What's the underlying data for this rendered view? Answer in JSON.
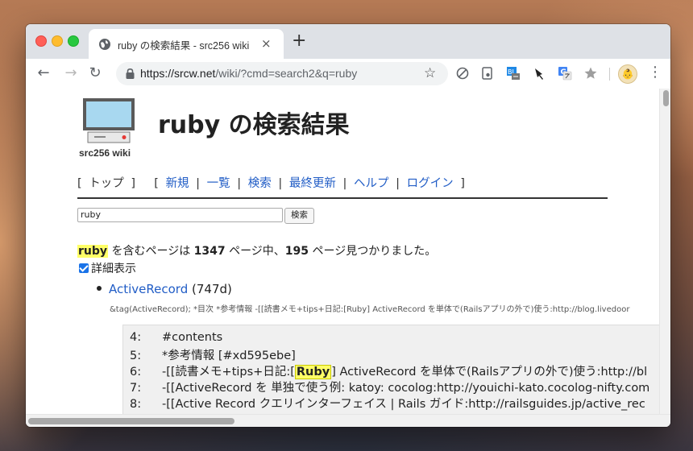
{
  "browser": {
    "tab_title": "ruby の検索結果 - src256 wiki",
    "tab_close": "×",
    "new_tab": "+",
    "url_host": "https://srcw.net",
    "url_path": "/wiki/?cmd=search2&q=ruby",
    "back": "←",
    "forward": "→",
    "reload": "↻",
    "bookmark_star": "☆",
    "menu": "⋮",
    "extensions": [
      "block-icon",
      "pocket-icon",
      "blog-icon",
      "pin-icon",
      "translate-icon",
      "star-extension-icon"
    ],
    "avatar_glyph": "👶"
  },
  "site": {
    "logo_caption": "src256 wiki",
    "page_title": "ruby の検索結果"
  },
  "nav": {
    "open_bracket": "[",
    "close_bracket": "]",
    "top": "トップ",
    "items": [
      "新規",
      "一覧",
      "検索",
      "最終更新",
      "ヘルプ",
      "ログイン"
    ],
    "separator": "|"
  },
  "search": {
    "query": "ruby",
    "button": "検索"
  },
  "summary": {
    "keyword": "ruby",
    "text_before": " を含むページは ",
    "total": "1347",
    "text_middle": " ページ中、",
    "found": "195",
    "text_after": " ページ見つかりました。"
  },
  "detail_toggle": {
    "label": "詳細表示",
    "checked": true
  },
  "results": [
    {
      "title": "ActiveRecord",
      "age": " (747d)",
      "snippet": "&tag(ActiveRecord); *目次 *参考情報 -[[読書メモ+tips+日記:[Ruby] ActiveRecord を単体で(Railsアプリの外で)使う:http://blog.livedoor",
      "lines": [
        {
          "num": "4:",
          "text": "#contents"
        },
        {
          "num": "5:",
          "text": "*参考情報 [#xd595ebe]"
        },
        {
          "num": "6:",
          "pre": "-[[読書メモ+tips+日記:[",
          "hl": "Ruby",
          "post": "] ActiveRecord を単体で(Railsアプリの外で)使う:http://bl"
        },
        {
          "num": "7:",
          "text": "-[[ActiveRecord を 単独で使う例: katoy: cocolog:http://youichi-kato.cocolog-nifty.com"
        },
        {
          "num": "8:",
          "text": "-[[Active Record クエリインターフェイス | Rails ガイド:http://railsguides.jp/active_rec"
        }
      ]
    }
  ],
  "colors": {
    "link": "#215dc6",
    "highlight": "#ffff66",
    "checkbox": "#1a73e8"
  }
}
